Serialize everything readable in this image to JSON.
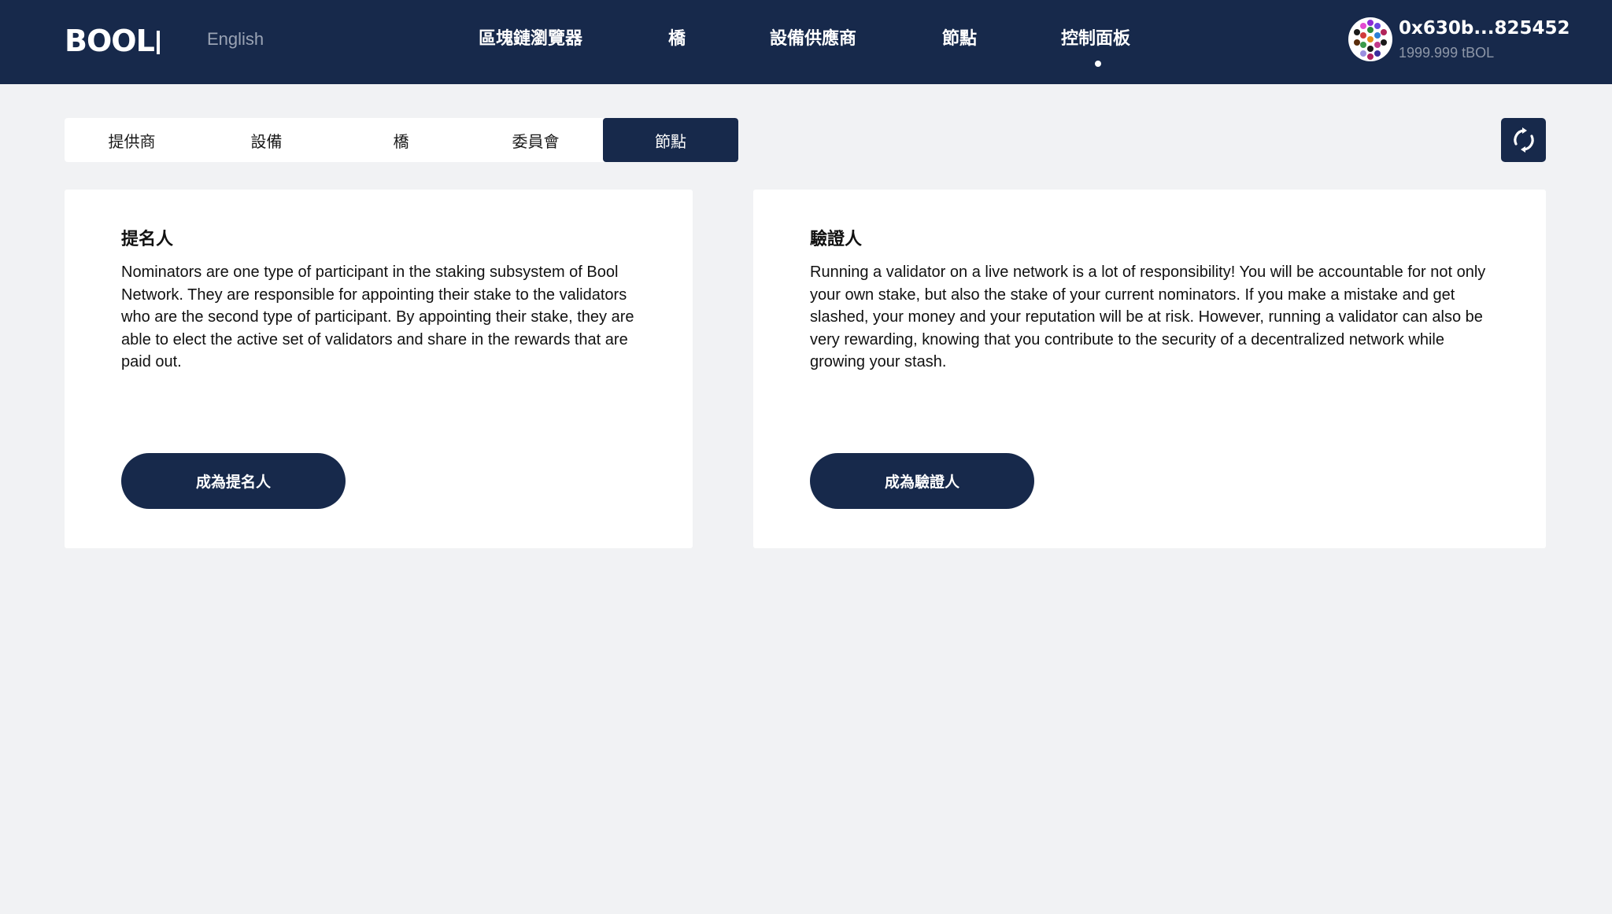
{
  "header": {
    "logo_text": "BOOL",
    "language": "English",
    "nav": [
      {
        "label": "區塊鏈瀏覽器"
      },
      {
        "label": "橋"
      },
      {
        "label": "設備供應商"
      },
      {
        "label": "節點"
      },
      {
        "label": "控制面板",
        "active": true
      }
    ],
    "account": {
      "address": "0x630b...825452",
      "balance": "1999.999 tBOL"
    }
  },
  "tabs": [
    {
      "label": "提供商"
    },
    {
      "label": "設備"
    },
    {
      "label": "橋"
    },
    {
      "label": "委員會"
    },
    {
      "label": "節點",
      "active": true
    }
  ],
  "refresh_icon": "refresh-icon",
  "cards": {
    "nominator": {
      "title": "提名人",
      "body": "Nominators are one type of participant in the staking subsystem of Bool Network. They are responsible for appointing their stake to the validators who are the second type of participant. By appointing their stake, they are able to elect the active set of validators and share in the rewards that are paid out.",
      "button": "成為提名人"
    },
    "validator": {
      "title": "驗證人",
      "body": "Running a validator on a live network is a lot of responsibility! You will be accountable for not only your own stake, but also the stake of your current nominators. If you make a mistake and get slashed, your money and your reputation will be at risk. However, running a validator can also be very rewarding, knowing that you contribute to the security of a decentralized network while growing your stash.",
      "button": "成為驗證人"
    }
  },
  "colors": {
    "navy": "#17294b",
    "background": "#f1f2f4",
    "card": "#ffffff",
    "muted_text": "#8e97a8"
  }
}
